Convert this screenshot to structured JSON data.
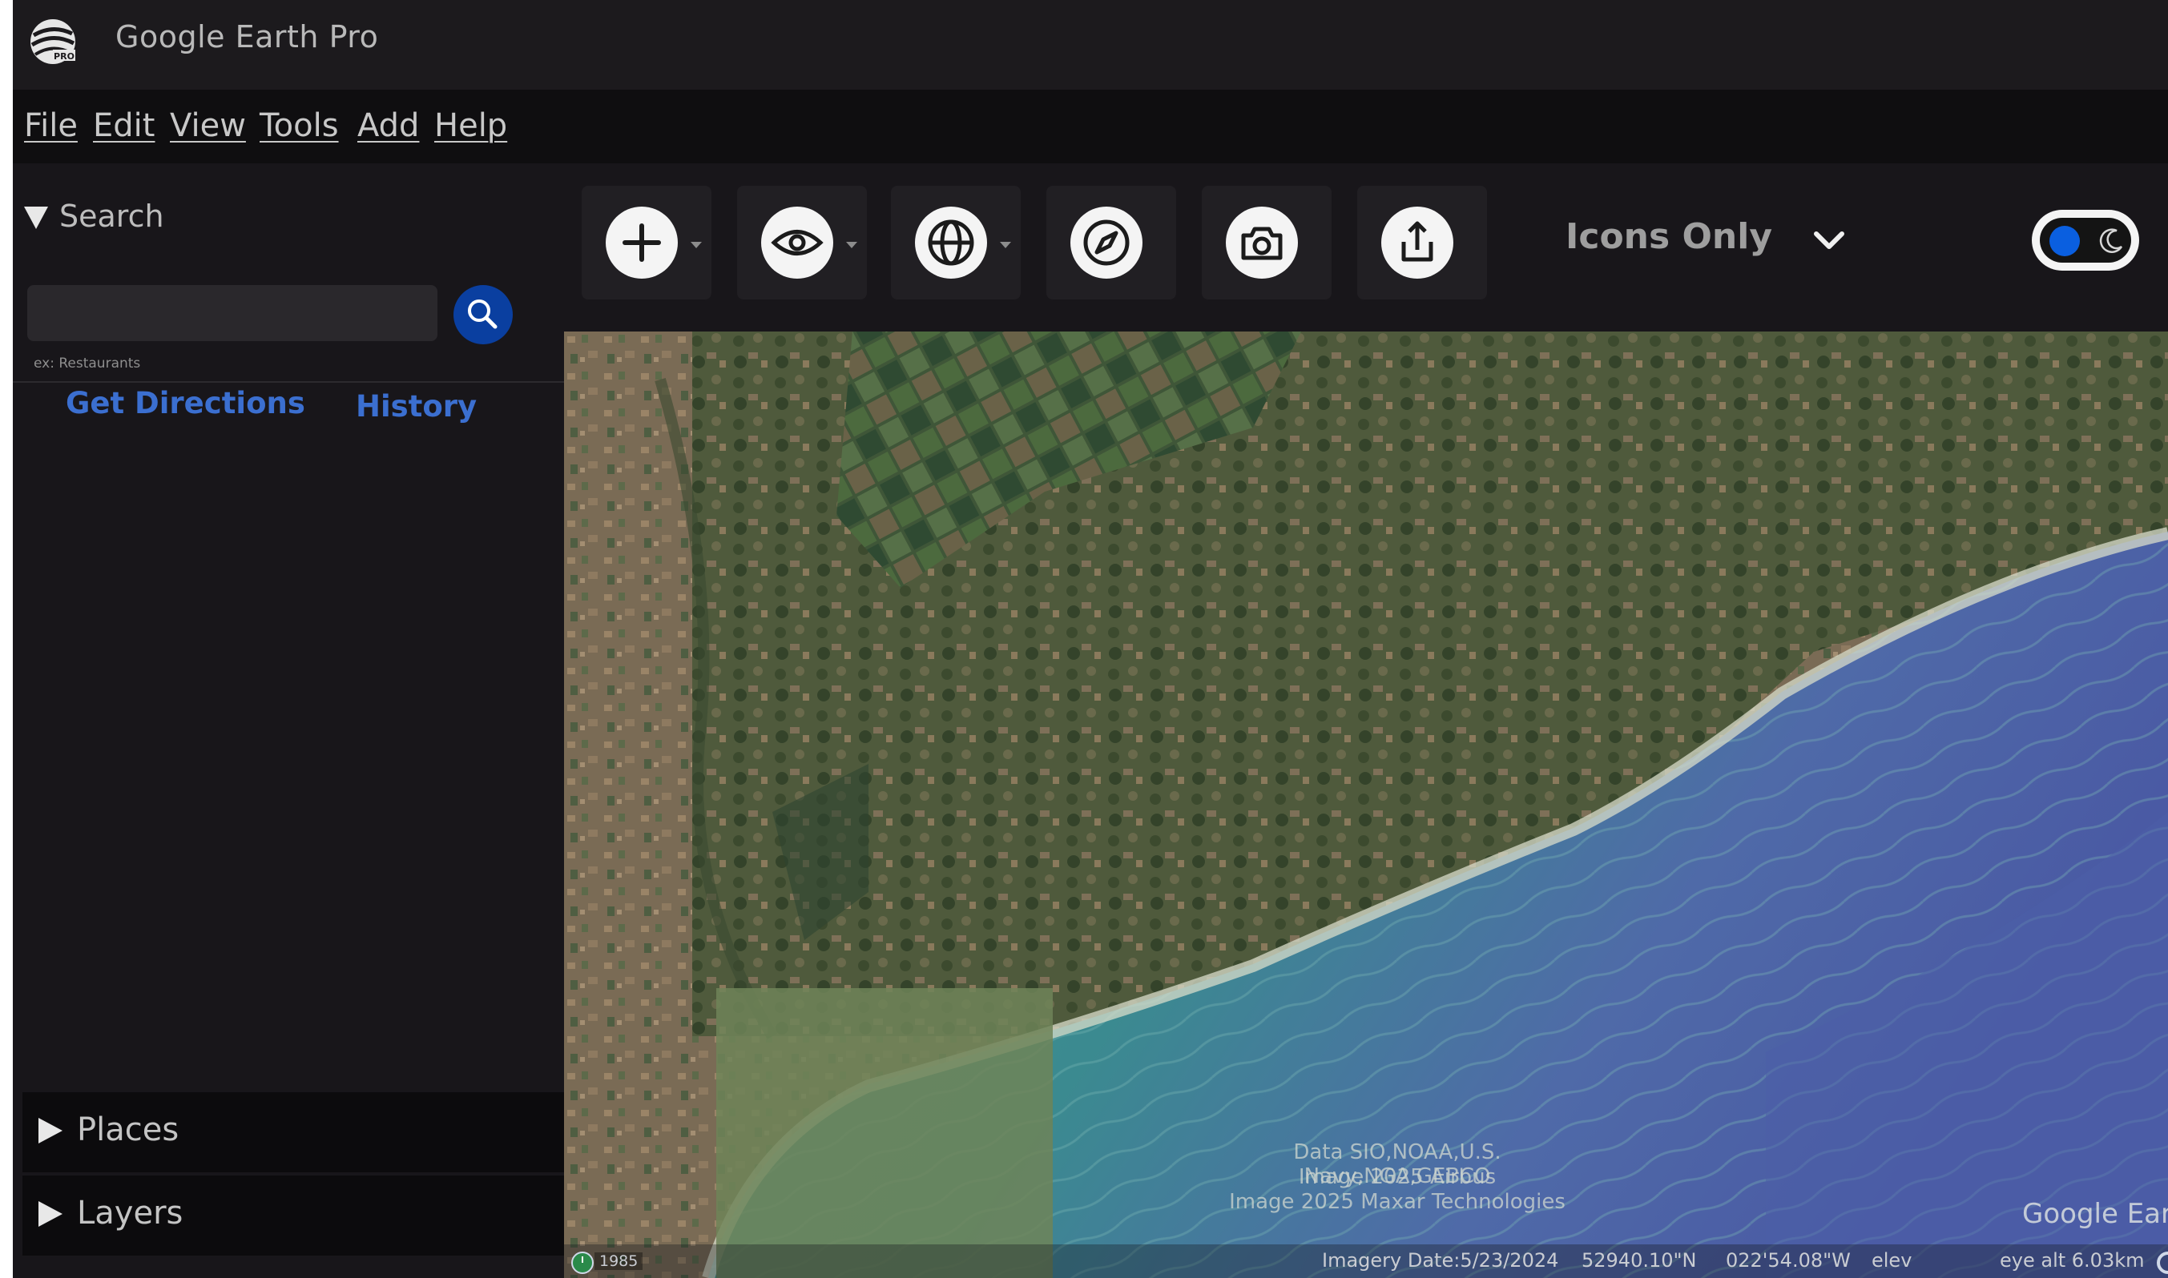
{
  "app": {
    "title": "Google Earth Pro"
  },
  "menu": {
    "file": "File",
    "edit": "Edit",
    "view": "View",
    "tools": "Tools",
    "add": "Add",
    "help": "Help"
  },
  "sidebar": {
    "search_header": "Search",
    "search_value": "",
    "search_hint": "ex: Restaurants",
    "get_directions": "Get Directions",
    "history": "History",
    "places": "Places",
    "layers": "Layers"
  },
  "toolbar": {
    "tools": [
      {
        "icon": "add-icon",
        "has_dropdown": true
      },
      {
        "icon": "eye-icon",
        "has_dropdown": true
      },
      {
        "icon": "globe-icon",
        "has_dropdown": true
      },
      {
        "icon": "compass-icon",
        "has_dropdown": false
      },
      {
        "icon": "camera-icon",
        "has_dropdown": false
      },
      {
        "icon": "share-icon",
        "has_dropdown": false
      }
    ],
    "view_mode": "Icons Only",
    "theme_toggle": {
      "on": true,
      "icon": "moon-icon",
      "accent": "#0a5fe0"
    }
  },
  "map": {
    "credits": [
      "Data SIO,NOAA,U.S. Navy,NGA,GEBCO",
      "Image  2025 Airbus",
      "Image 2025 Maxar Technologies"
    ],
    "watermark": "Google Earth",
    "status": {
      "year": "1985",
      "imagery_date": "Imagery Date:5/23/2024",
      "lat": "52940.10\"N",
      "lon": "022'54.08\"W",
      "elev": "elev",
      "eye_alt": "eye alt  6.03km"
    }
  },
  "colors": {
    "accent": "#0a3fa0",
    "link": "#3b6fd0",
    "background": "#18161a"
  }
}
